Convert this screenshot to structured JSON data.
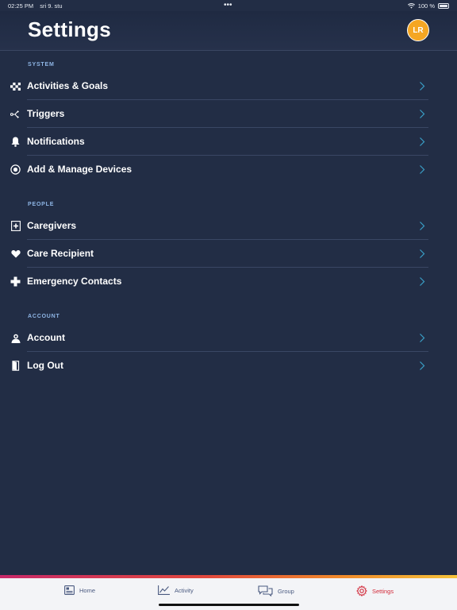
{
  "status_bar": {
    "time": "02:25 PM",
    "date": "sri 9. stu",
    "dots": "•••",
    "battery": "100 %",
    "battery_level": 1.0
  },
  "header": {
    "title": "Settings",
    "avatar_initials": "LR"
  },
  "sections": [
    {
      "label": "SYSTEM",
      "items": [
        {
          "label": "Activities & Goals",
          "icon": "checkered-flag-icon"
        },
        {
          "label": "Triggers",
          "icon": "triggers-icon"
        },
        {
          "label": "Notifications",
          "icon": "bell-icon"
        },
        {
          "label": "Add & Manage Devices",
          "icon": "device-icon"
        }
      ]
    },
    {
      "label": "PEOPLE",
      "items": [
        {
          "label": "Caregivers",
          "icon": "caregivers-icon"
        },
        {
          "label": "Care Recipient",
          "icon": "heart-icon"
        },
        {
          "label": "Emergency Contacts",
          "icon": "plus-icon"
        }
      ]
    },
    {
      "label": "ACCOUNT",
      "items": [
        {
          "label": "Account",
          "icon": "user-icon"
        },
        {
          "label": "Log Out",
          "icon": "logout-icon"
        }
      ]
    }
  ],
  "tab_bar": {
    "tabs": [
      {
        "label": "Home",
        "icon": "home-icon"
      },
      {
        "label": "Activity",
        "icon": "activity-chart-icon"
      },
      {
        "label": "Group",
        "icon": "chat-bubbles-icon"
      },
      {
        "label": "Settings",
        "icon": "gear-icon",
        "active": true
      }
    ]
  },
  "colors": {
    "background": "#222d45",
    "section_label": "#8fb6e6",
    "chevron": "#3aa0c8",
    "avatar": "#f5a623",
    "active_tab": "#d22a3a",
    "inactive_tab": "#4a5a80"
  }
}
